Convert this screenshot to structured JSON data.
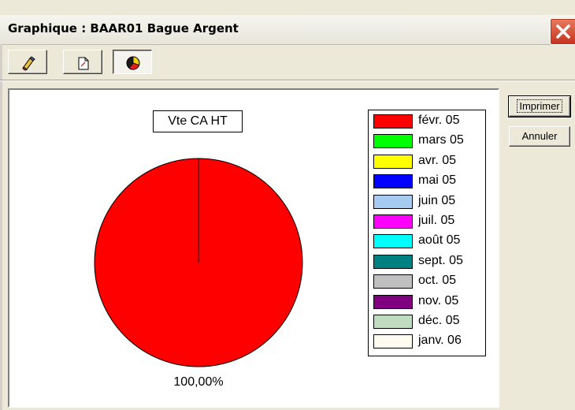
{
  "window": {
    "title": "Graphique : BAAR01 Bague Argent"
  },
  "toolbar": {
    "buttons": [
      {
        "icon": "eraser-icon",
        "pressed": false
      },
      {
        "icon": "edit-page-icon",
        "pressed": false
      },
      {
        "icon": "pie-chart-icon",
        "pressed": true
      }
    ]
  },
  "actions": {
    "print_label": "Imprimer",
    "cancel_label": "Annuler"
  },
  "chart_data": {
    "type": "pie",
    "title": "Vte CA HT",
    "slices": [
      {
        "label": "févr. 05",
        "value": 100.0,
        "color": "#ff0000"
      }
    ],
    "value_labels": [
      "100,00%"
    ],
    "legend": [
      {
        "label": "févr. 05",
        "color": "#ff0000"
      },
      {
        "label": "mars 05",
        "color": "#00ff00"
      },
      {
        "label": "avr. 05",
        "color": "#ffff00"
      },
      {
        "label": "mai 05",
        "color": "#0000ff"
      },
      {
        "label": "juin 05",
        "color": "#a6caf0"
      },
      {
        "label": "juil. 05",
        "color": "#ff00ff"
      },
      {
        "label": "août 05",
        "color": "#00ffff"
      },
      {
        "label": "sept. 05",
        "color": "#008080"
      },
      {
        "label": "oct. 05",
        "color": "#c0c0c0"
      },
      {
        "label": "nov. 05",
        "color": "#800080"
      },
      {
        "label": "déc. 05",
        "color": "#c0dcc0"
      },
      {
        "label": "janv. 06",
        "color": "#fffbf0"
      }
    ],
    "legend_position": "right"
  }
}
